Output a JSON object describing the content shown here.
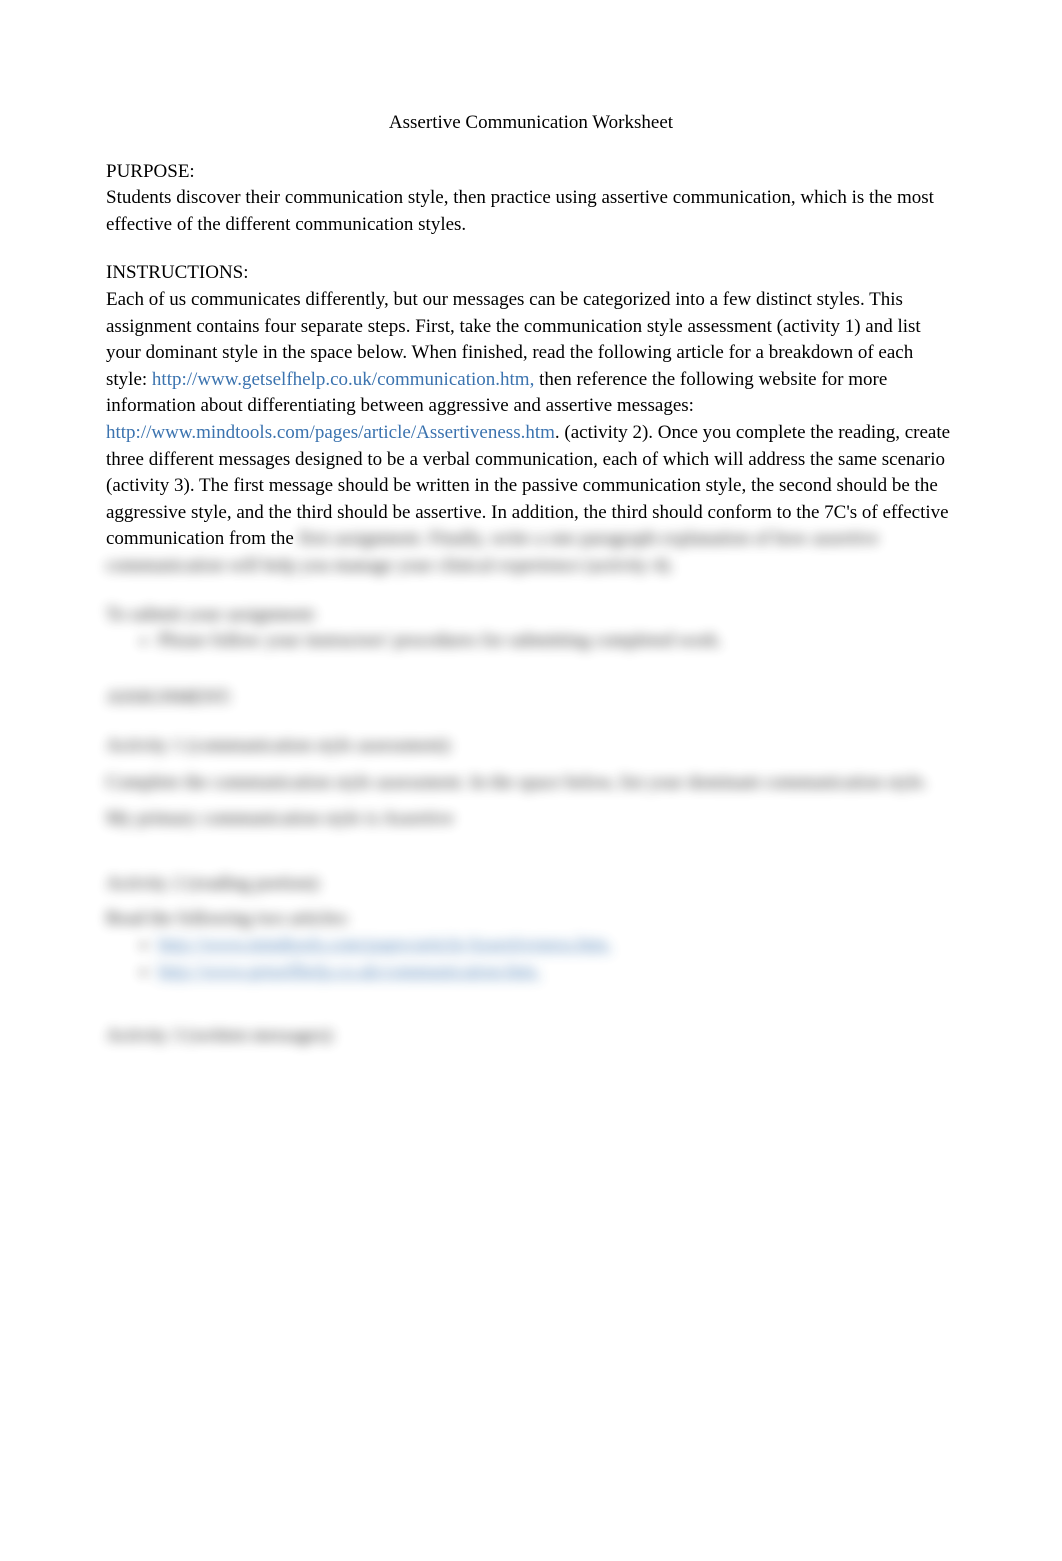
{
  "title": "Assertive Communication Worksheet",
  "purpose": {
    "heading": "PURPOSE:",
    "body": "Students discover their communication style, then practice using assertive communication, which is the most effective of the different communication styles."
  },
  "instructions": {
    "heading": "INSTRUCTIONS:",
    "body1": "Each of us communicates differently, but our messages can be categorized into a few distinct styles. This assignment contains four separate steps. First, take the communication style assessment (activity 1) and list your dominant style in the space below. When finished, read the following article for a breakdown of each style: ",
    "link1": "http://www.getselfhelp.co.uk/communication.htm,",
    "body2": " then reference the following website for more information about differentiating between aggressive and assertive messages: ",
    "link2": "http://www.mindtools.com/pages/article/Assertiveness.htm",
    "body3": ". (activity 2). Once you complete the reading, create three different messages designed to be a verbal communication, each of which will address the same scenario (activity 3). The first message should be written in the passive communication style, the second should be the aggressive style, and the third should be assertive. In addition, the third should conform to the 7C's of effective communication from the ",
    "body3_blur": "first assignment. Finally, write a one paragraph explanation of how assertive communication will help you manage your clinical experience (activity 4)."
  },
  "submit": {
    "heading": "To submit your assignment:",
    "bullet": "Please follow your instructors' procedures for submitting completed work."
  },
  "assignment": {
    "heading": "ASSIGNMENT:"
  },
  "activity1": {
    "heading": "Activity 1 (communication style assessment):",
    "body": "Complete the communication style assessment. In the space below, list your dominant communication style.",
    "answer": "My primary communication style is Assertive"
  },
  "activity2": {
    "heading": "Activity 2 (reading portion):",
    "body": "Read the following two articles:",
    "link1": "http://www.mindtools.com/pages/article/Assertiveness.htm.",
    "link2": "http://www.getselfhelp.co.uk/communication.htm."
  },
  "activity3": {
    "heading": "Activity 3 (written messages):"
  }
}
